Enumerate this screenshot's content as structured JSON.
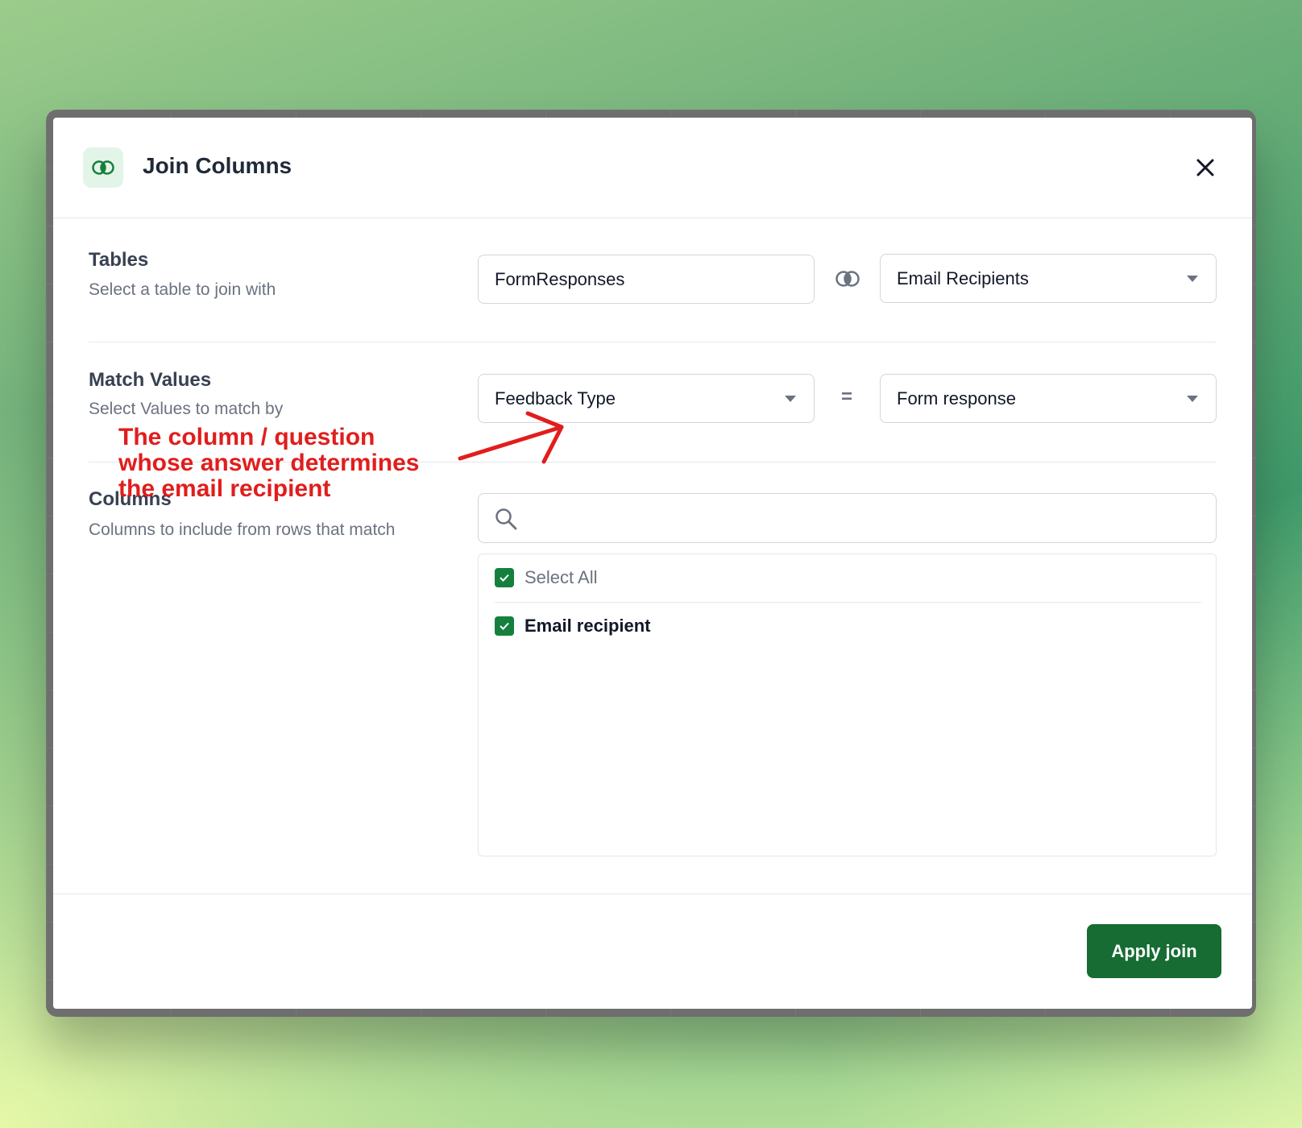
{
  "modal": {
    "title": "Join Columns",
    "icon": "join-icon"
  },
  "tables": {
    "title": "Tables",
    "description": "Select a table to join with",
    "left_table": "FormResponses",
    "right_table": "Email Recipients"
  },
  "match_values": {
    "title": "Match Values",
    "description": "Select Values to match by",
    "left_column": "Feedback Type",
    "operator": "=",
    "right_column": "Form response"
  },
  "columns": {
    "title": "Columns",
    "description": "Columns to include from rows that match",
    "search_value": "",
    "select_all_label": "Select All",
    "select_all_checked": true,
    "items": [
      {
        "label": "Email recipient",
        "checked": true
      }
    ]
  },
  "annotation": {
    "text_lines": [
      "The column / question",
      "whose answer determines",
      "the email recipient"
    ],
    "color": "#e11d1d"
  },
  "footer": {
    "apply_label": "Apply join"
  },
  "colors": {
    "accent": "#166c32",
    "checkbox": "#15803d"
  }
}
